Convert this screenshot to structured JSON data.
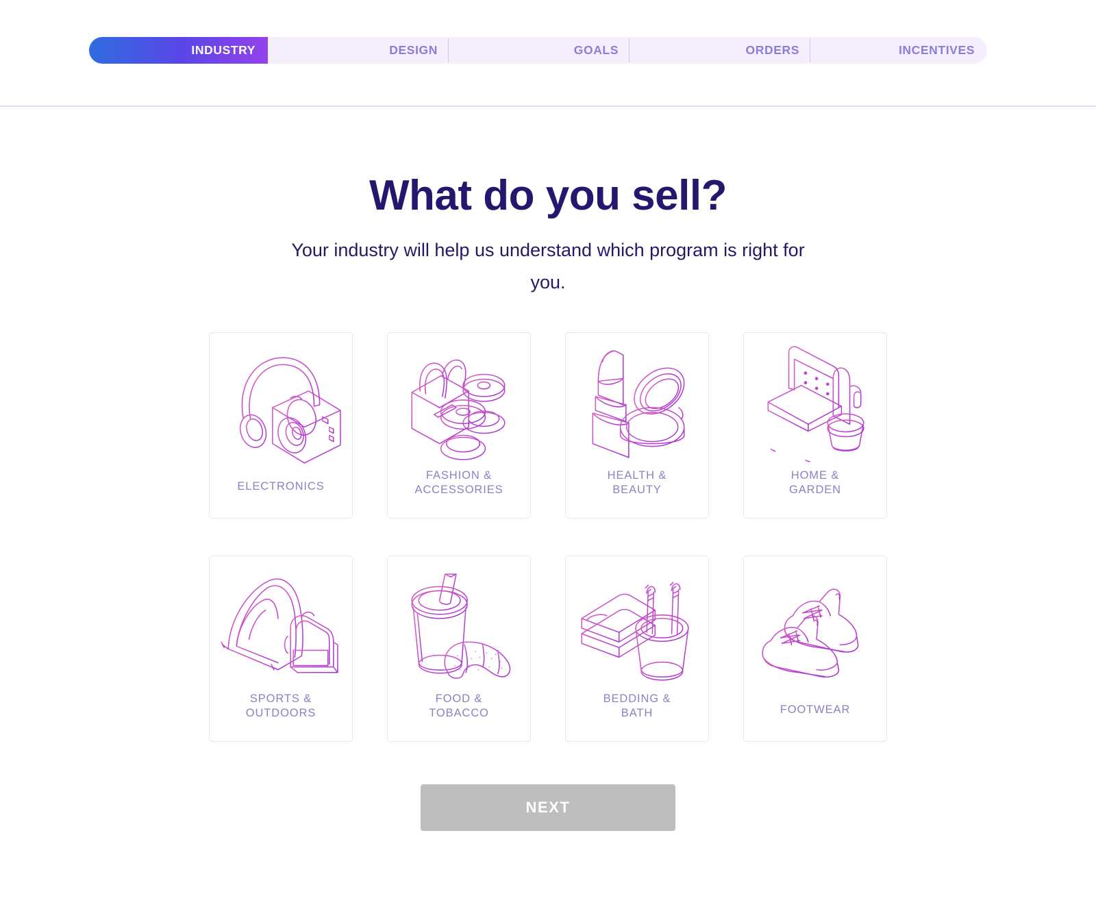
{
  "stepper": {
    "steps": [
      {
        "label": "INDUSTRY",
        "active": true
      },
      {
        "label": "DESIGN",
        "active": false
      },
      {
        "label": "GOALS",
        "active": false
      },
      {
        "label": "ORDERS",
        "active": false
      },
      {
        "label": "INCENTIVES",
        "active": false
      }
    ],
    "active_gradient_from": "#2f6ce0",
    "active_gradient_mid": "#5a46e8",
    "active_gradient_to": "#9342ec",
    "track_color": "#f4eefd",
    "inactive_label_color": "#8b7ed8",
    "divider_color": "#cfc4ef"
  },
  "header": {
    "title": "What do you sell?",
    "subtitle": "Your industry will help us understand which program is right for you.",
    "title_color": "#24176e",
    "subtitle_color": "#221a66",
    "rule_color": "#e3dcfa"
  },
  "industry_grid": {
    "cards": [
      {
        "label": "ELECTRONICS",
        "icon": "headphones-camera-icon",
        "selected": false
      },
      {
        "label": "FASHION &\nACCESSORIES",
        "icon": "handbag-thread-spools-icon",
        "selected": false
      },
      {
        "label": "HEALTH &\nBEAUTY",
        "icon": "lipstick-compact-icon",
        "selected": false
      },
      {
        "label": "HOME &\nGARDEN",
        "icon": "chair-cactus-icon",
        "selected": false
      },
      {
        "label": "SPORTS &\nOUTDOORS",
        "icon": "tent-backpack-icon",
        "selected": false
      },
      {
        "label": "FOOD &\nTOBACCO",
        "icon": "drink-croissant-icon",
        "selected": false
      },
      {
        "label": "BEDDING &\nBATH",
        "icon": "towels-toothbrush-icon",
        "selected": false
      },
      {
        "label": "FOOTWEAR",
        "icon": "sneakers-icon",
        "selected": false
      }
    ],
    "card_border_color": "#e8e4fb",
    "label_color": "#8b81c4",
    "art_stroke_from": "#d95fc0",
    "art_stroke_to": "#a82fd8"
  },
  "footer": {
    "next_label": "NEXT",
    "next_enabled": false,
    "next_bg": "#bebebe",
    "next_text_color": "#ffffff"
  }
}
